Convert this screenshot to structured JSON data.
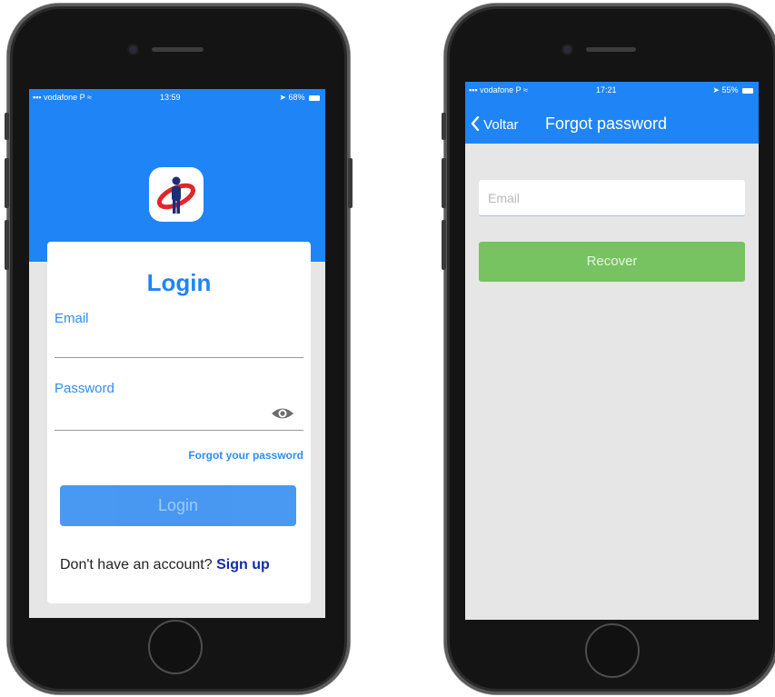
{
  "left_phone": {
    "status": {
      "carrier": "vodafone P",
      "time": "13:59",
      "battery": "68%"
    },
    "login_title": "Login",
    "email_label": "Email",
    "password_label": "Password",
    "forgot_link": "Forgot your password",
    "login_button": "Login",
    "signup_prompt": "Don't have an account?",
    "signup_link": "Sign up",
    "icons": {
      "wifi": "wifi-icon",
      "location": "location-arrow-icon",
      "eye": "eye-icon",
      "logo": "app-logo"
    }
  },
  "right_phone": {
    "status": {
      "carrier": "vodafone P",
      "time": "17:21",
      "battery": "55%"
    },
    "back_label": "Voltar",
    "nav_title": "Forgot password",
    "email_placeholder": "Email",
    "recover_button": "Recover",
    "icons": {
      "back": "chevron-left-icon"
    }
  },
  "colors": {
    "primary": "#1f84f5",
    "recover": "#77c261",
    "signup": "#0f2fa6",
    "screen_bg": "#e6e6e6"
  }
}
